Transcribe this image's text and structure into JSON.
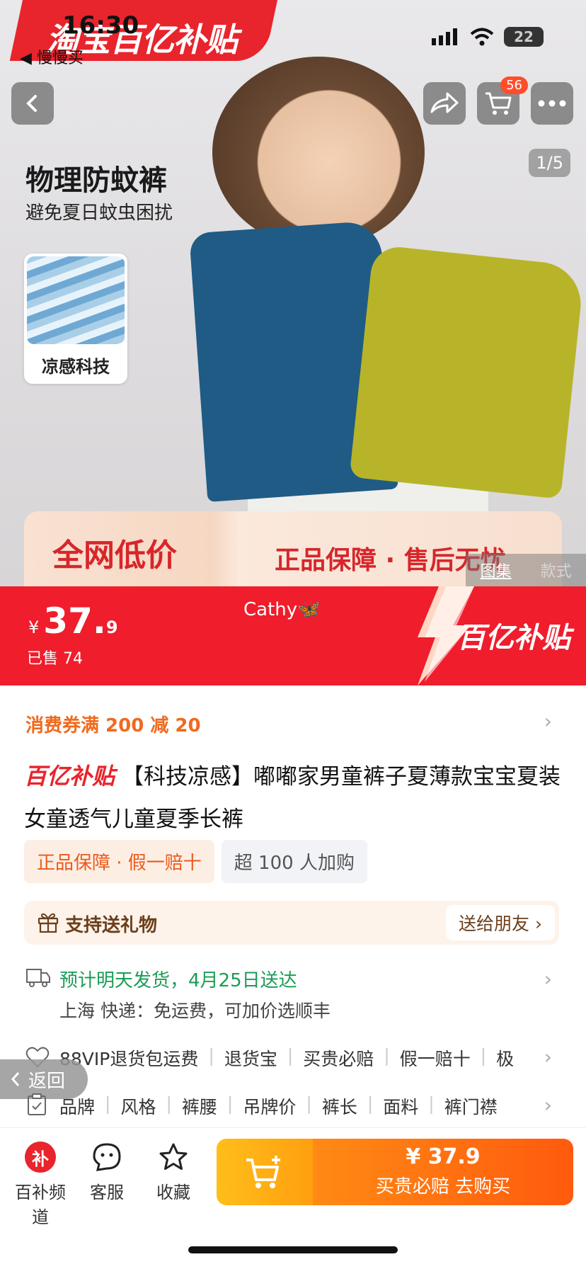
{
  "status_bar": {
    "time": "16:30",
    "back_app": "◀ 慢慢买",
    "battery": "22"
  },
  "hero": {
    "banner_text": "淘宝百亿补贴",
    "cart_badge": "56",
    "counter": "1/5",
    "title": "物理防蚊裤",
    "subtitle": "避免夏日蚊虫困扰",
    "tech_label": "凉感科技",
    "promo_left": "全网低价",
    "promo_right": "正品保障 · 售后无忧",
    "tabs": [
      "图集",
      "款式"
    ]
  },
  "price": {
    "currency": "¥",
    "integer": "37.",
    "decimal": "9",
    "sold": "已售 74",
    "watermark": "Cathy🦋",
    "brand": "百亿补贴"
  },
  "coupon": "消费券满 200 减 20",
  "product": {
    "brand_tag": "百亿补贴",
    "title": "【科技凉感】嘟嘟家男童裤子夏薄款宝宝夏装女童透气儿童夏季长裤"
  },
  "tags": [
    "正品保障 · 假一赔十",
    "超 100 人加购"
  ],
  "gift": {
    "label": "支持送礼物",
    "button": "送给朋友 ›"
  },
  "shipping": {
    "line1": "预计明天发货，4月25日送达",
    "line2": "上海  快递：免运费，可加价选顺丰"
  },
  "services": [
    "88VIP退货包运费",
    "退货宝",
    "买贵必赔",
    "假一赔十",
    "极"
  ],
  "attributes": [
    "品牌",
    "风格",
    "裤腰",
    "吊牌价",
    "裤长",
    "面料",
    "裤门襟"
  ],
  "return_button": "返回",
  "bottom_bar": {
    "items": [
      {
        "label": "百补频道",
        "icon": "subsidy-icon",
        "icon_text": "补"
      },
      {
        "label": "客服",
        "icon": "service-icon"
      },
      {
        "label": "收藏",
        "icon": "star-icon"
      }
    ],
    "buy_price": "¥ 37.9",
    "buy_text": "买贵必赔  去购买"
  },
  "colors": {
    "brand_red": "#f01d2c",
    "buy_orange": "#ff5a0e",
    "cart_yellow": "#ffbe1a",
    "green": "#1b9c55"
  }
}
